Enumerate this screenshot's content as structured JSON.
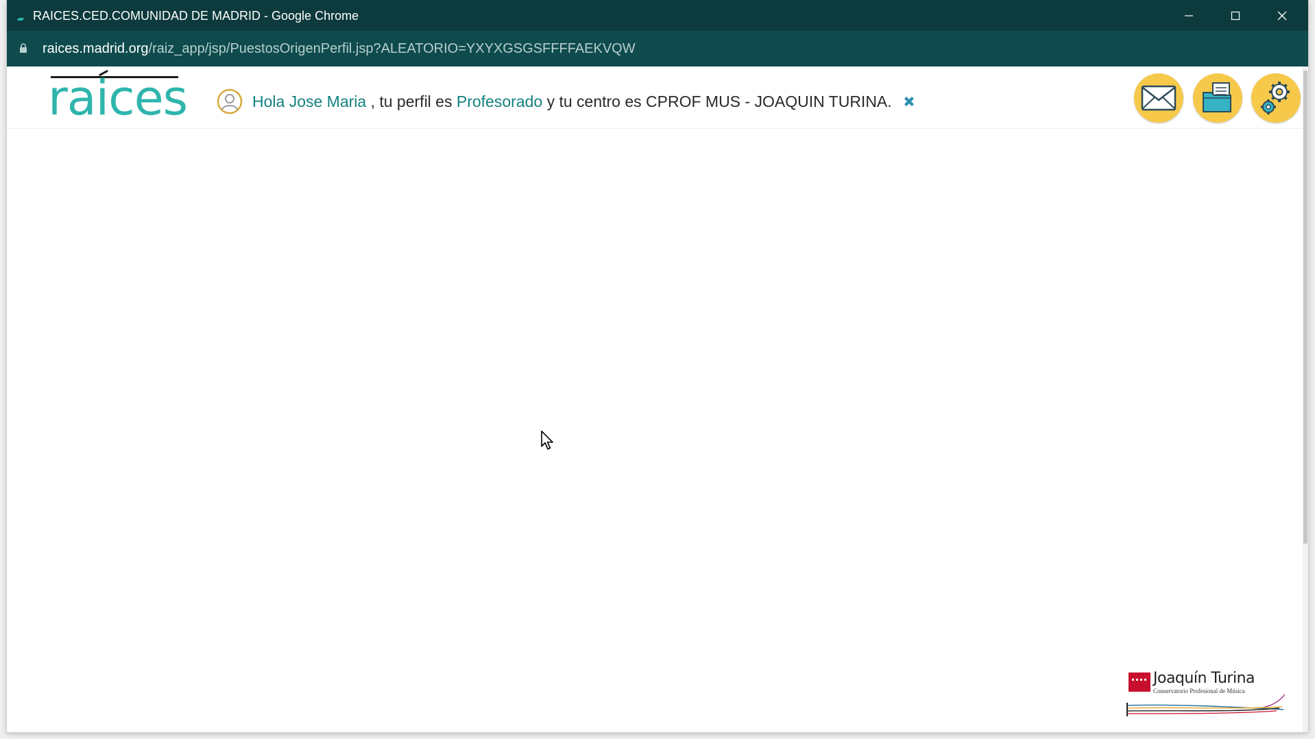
{
  "window": {
    "title": "RAICES.CED.COMUNIDAD DE MADRID - Google Chrome"
  },
  "address_bar": {
    "url_host": "raices.madrid.org",
    "url_path": "/raiz_app/jsp/PuestosOrigenPerfil.jsp?ALEATORIO=YXYXGSGSFFFFAEKVQW"
  },
  "header": {
    "logo_text": "raices",
    "greeting": {
      "hello": "Hola Jose Maria",
      "profile_prefix": ", tu perfil es",
      "profile": "Profesorado",
      "center_text": "y tu centro es CPROF MUS - JOAQUIN TURINA."
    },
    "buttons": {
      "mail_icon": "envelope-icon",
      "docs_icon": "documents-folder-icon",
      "settings_icon": "gears-icon"
    }
  },
  "footer": {
    "logo_name": "Joaquín Turina",
    "logo_subtitle": "Conservatorio Profesional de Música"
  },
  "colors": {
    "titlebar": "#0d3a3c",
    "addressbar": "#0f4b4c",
    "brand_teal": "#2fb5ad",
    "link_teal": "#13817f",
    "button_yellow": "#f6c94b"
  }
}
